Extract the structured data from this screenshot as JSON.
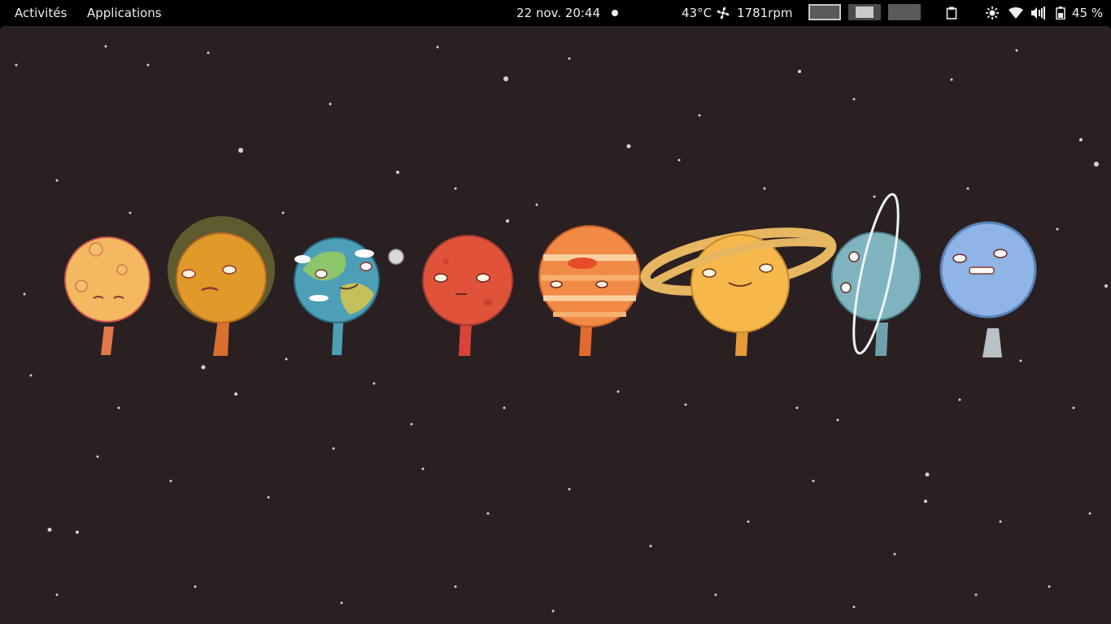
{
  "topbar": {
    "activities_label": "Activités",
    "applications_label": "Applications",
    "clock": "22 nov.  20:44",
    "temperature": "43°C",
    "fan_speed": "1781rpm",
    "battery_percent": "45 %",
    "workspaces": [
      {
        "name": "workspace-1",
        "active": true
      },
      {
        "name": "workspace-2",
        "active": false
      },
      {
        "name": "workspace-3",
        "active": false
      }
    ],
    "icons": [
      "notification-dot-icon",
      "fan-icon",
      "clipboard-icon",
      "brightness-icon",
      "wifi-icon",
      "volume-icon",
      "battery-icon"
    ]
  },
  "desktop": {
    "background_color": "#2a2022",
    "wallpaper_subject": "cartoon planets of the solar system in a row",
    "planets": [
      {
        "name": "mercury",
        "color": "#f4b860"
      },
      {
        "name": "venus",
        "color": "#e09a2a"
      },
      {
        "name": "earth",
        "color": "#4d9fb8"
      },
      {
        "name": "mars",
        "color": "#e0533a"
      },
      {
        "name": "jupiter",
        "color": "#f08a45"
      },
      {
        "name": "saturn",
        "color": "#f6b84a"
      },
      {
        "name": "uranus",
        "color": "#7fb3bf"
      },
      {
        "name": "neptune",
        "color": "#8fb4e6"
      }
    ]
  }
}
